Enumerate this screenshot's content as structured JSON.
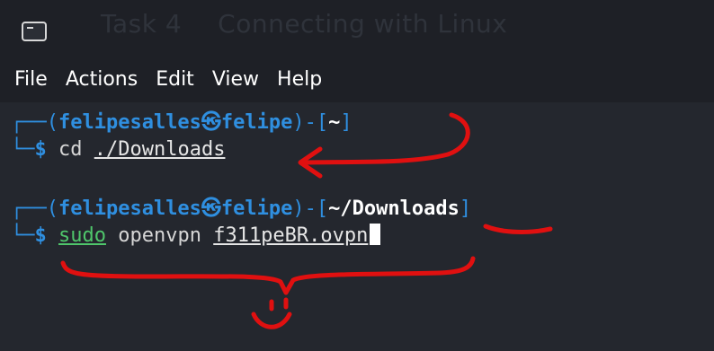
{
  "window": {
    "icon": "terminal-icon",
    "background_heading": {
      "task": "Task 4",
      "title": "Connecting with Linux"
    }
  },
  "menu": [
    "File",
    "Actions",
    "Edit",
    "View",
    "Help"
  ],
  "terminal": {
    "prompt1": {
      "open": "┌──(",
      "user": "felipesalles㉿felipe",
      "mid": ")-[",
      "path": "~",
      "close": "]"
    },
    "cmd1": {
      "prefix": "└─",
      "symbol": "$",
      "command": "cd",
      "arg": "./Downloads"
    },
    "prompt2": {
      "open": "┌──(",
      "user": "felipesalles㉿felipe",
      "mid": ")-[",
      "path": "~/Downloads",
      "close": "]"
    },
    "cmd2": {
      "prefix": "└─",
      "symbol": "$",
      "sudo": "sudo",
      "command": "openvpn",
      "arg": "f311peBR.ovpn"
    }
  },
  "colors": {
    "accent_blue": "#2f8fe0",
    "command_green": "#4fc66b",
    "annotation_red": "#e01010"
  }
}
